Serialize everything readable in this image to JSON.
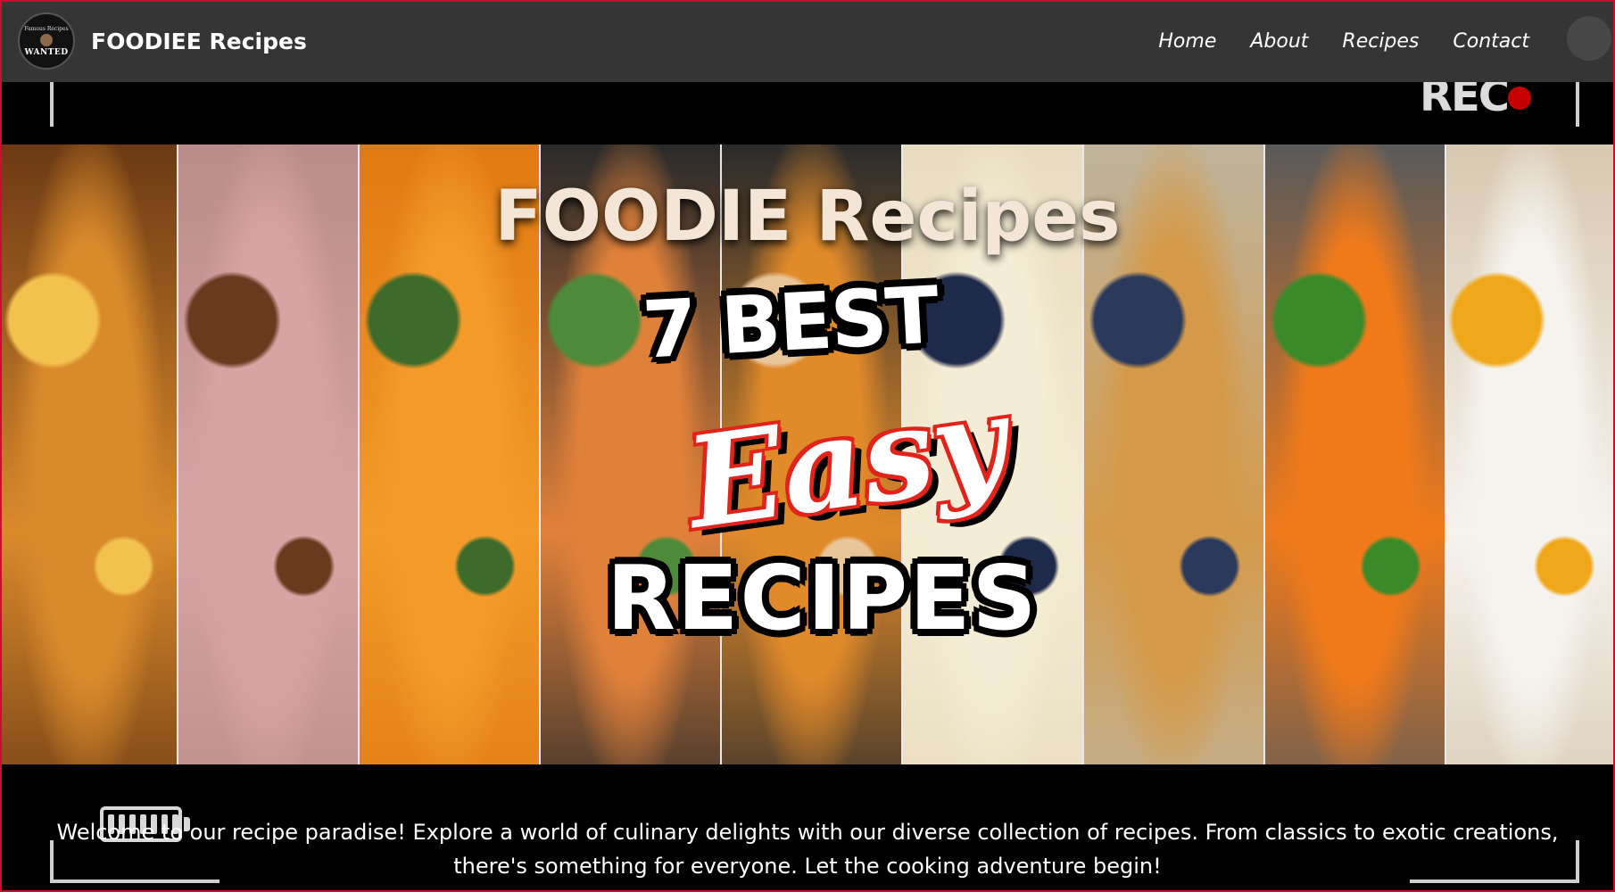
{
  "brand": {
    "name": "FOODIEE Recipes",
    "logo_text": "WANTED",
    "logo_small_text": "Famous Recipes"
  },
  "nav": {
    "items": [
      {
        "label": "Home"
      },
      {
        "label": "About"
      },
      {
        "label": "Recipes"
      },
      {
        "label": "Contact"
      }
    ]
  },
  "hero": {
    "title": "FOODIE Recipes",
    "overlay_rec": "REC",
    "headline_line1": "7 BEST",
    "headline_line2": "Easy",
    "headline_line3": "RECIPES",
    "panels": [
      {
        "name": "chicken-panel",
        "base": "#6b3a14",
        "accent": "#d98a2b",
        "highlight": "#f2c14e"
      },
      {
        "name": "pork-panel",
        "base": "#b98c8c",
        "accent": "#d9a3a3",
        "highlight": "#6b3a1e"
      },
      {
        "name": "salmon-orange-panel",
        "base": "#e07a12",
        "accent": "#f39a2a",
        "highlight": "#3c6b2a"
      },
      {
        "name": "salmon-greens-panel",
        "base": "#2a2a2a",
        "accent": "#e0813a",
        "highlight": "#4d8a3a"
      },
      {
        "name": "bowl-panel",
        "base": "#2b2b2b",
        "accent": "#e08a2a",
        "highlight": "#e9c59a"
      },
      {
        "name": "banana-blueberry-panel",
        "base": "#e8dcc0",
        "accent": "#f4ecd4",
        "highlight": "#1f2a4a"
      },
      {
        "name": "waffle-panel",
        "base": "#bfb49c",
        "accent": "#d49a4a",
        "highlight": "#2b3a5c"
      },
      {
        "name": "fries-panel",
        "base": "#5a5a5a",
        "accent": "#f07a1a",
        "highlight": "#3b8a2a"
      },
      {
        "name": "egg-toast-panel",
        "base": "#d8c8b0",
        "accent": "#f5f3ee",
        "highlight": "#f0a81a"
      }
    ]
  },
  "welcome": {
    "text": "Welcome to our recipe paradise! Explore a world of culinary delights with our diverse collection of recipes. From classics to exotic creations, there's something for everyone. Let the cooking adventure begin!"
  },
  "colors": {
    "navbar_bg": "#353535",
    "page_border": "#c8102e",
    "title_color": "#f4e6d6",
    "easy_red": "#e0231b"
  }
}
